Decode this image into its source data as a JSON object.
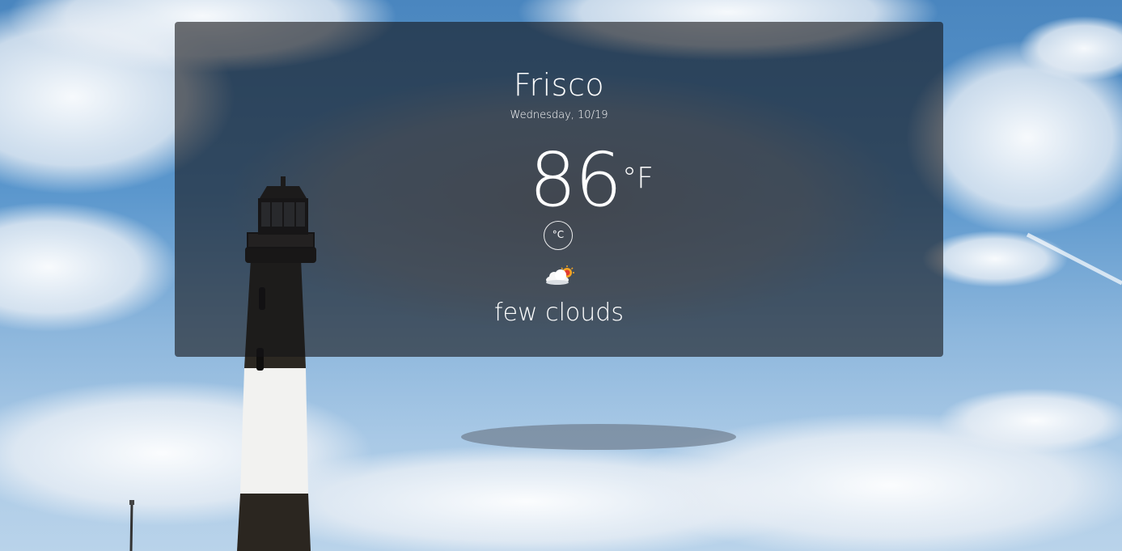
{
  "weather": {
    "city": "Frisco",
    "date": "Wednesday, 10/19",
    "temperature": "86",
    "unit": "°F",
    "toggle_unit": "°C",
    "icon": "few-clouds-icon",
    "description": "few clouds"
  },
  "colors": {
    "card_background": "#141418",
    "text": "#ffffff",
    "sky": "#5b97cd"
  }
}
